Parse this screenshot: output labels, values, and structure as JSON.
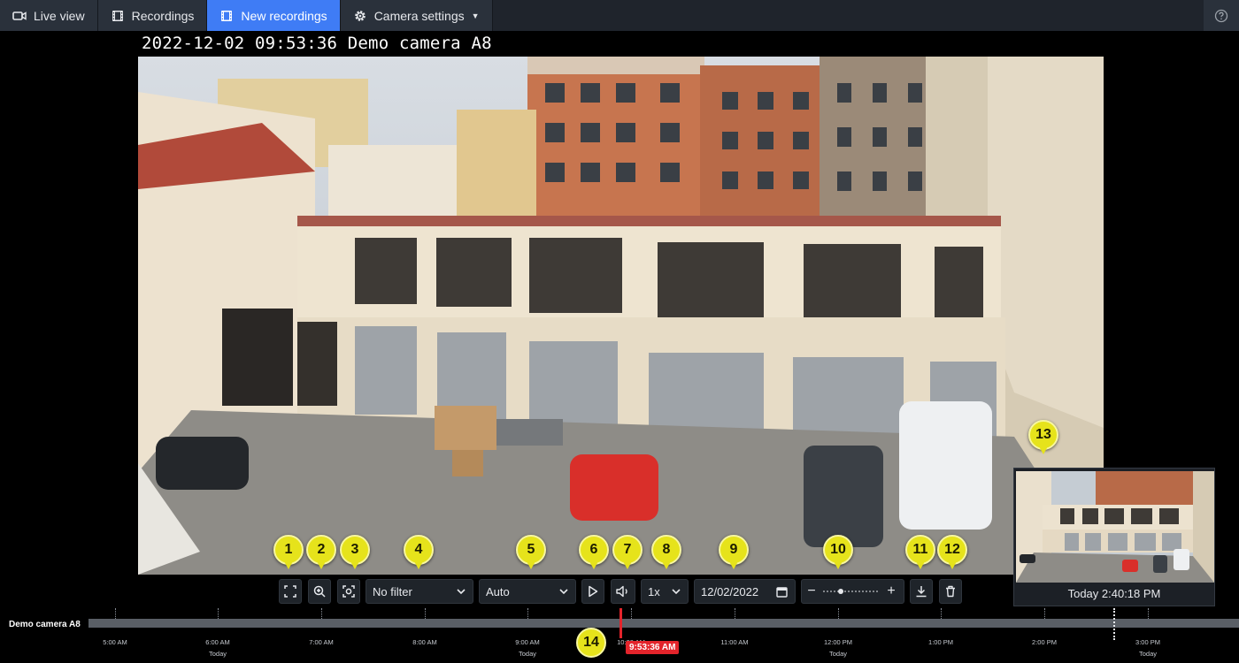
{
  "nav": {
    "tabs": [
      {
        "label": "Live view",
        "icon": "video-camera-icon",
        "active": false
      },
      {
        "label": "Recordings",
        "icon": "film-icon",
        "active": false
      },
      {
        "label": "New recordings",
        "icon": "film-icon",
        "active": true
      },
      {
        "label": "Camera settings",
        "icon": "gear-icon",
        "active": false,
        "dropdown": true
      }
    ],
    "help_icon": "help-circle-icon"
  },
  "video": {
    "overlay_text": "2022-12-02 09:53:36 Demo camera A8"
  },
  "controls": {
    "fullscreen_icon": "fullscreen-icon",
    "zoom_icon": "zoom-in-icon",
    "snapshot_icon": "snapshot-icon",
    "filter": "No filter",
    "quality": "Auto",
    "play_icon": "play-icon",
    "audio_icon": "speaker-icon",
    "speed": "1x",
    "date": "12/02/2022",
    "calendar_icon": "calendar-icon",
    "zoom_minus": "−",
    "zoom_plus": "+",
    "download_icon": "download-icon",
    "delete_icon": "trash-icon"
  },
  "markers": [
    "1",
    "2",
    "3",
    "4",
    "5",
    "6",
    "7",
    "8",
    "9",
    "10",
    "11",
    "12",
    "13",
    "14"
  ],
  "preview": {
    "time": "Today 2:40:18 PM"
  },
  "timeline": {
    "camera": "Demo camera A8",
    "ticks": [
      {
        "label": "5:00 AM",
        "sub": ""
      },
      {
        "label": "6:00 AM",
        "sub": "Today"
      },
      {
        "label": "7:00 AM",
        "sub": ""
      },
      {
        "label": "8:00 AM",
        "sub": ""
      },
      {
        "label": "9:00 AM",
        "sub": "Today"
      },
      {
        "label": "10:00 AM",
        "sub": ""
      },
      {
        "label": "11:00 AM",
        "sub": ""
      },
      {
        "label": "12:00 PM",
        "sub": "Today"
      },
      {
        "label": "1:00 PM",
        "sub": ""
      },
      {
        "label": "2:00 PM",
        "sub": ""
      },
      {
        "label": "3:00 PM",
        "sub": "Today"
      }
    ],
    "cursor_time": "9:53:36 AM"
  },
  "colors": {
    "accent": "#3f7cf5",
    "marker": "#e6e31b",
    "cursor": "#e3242b"
  }
}
